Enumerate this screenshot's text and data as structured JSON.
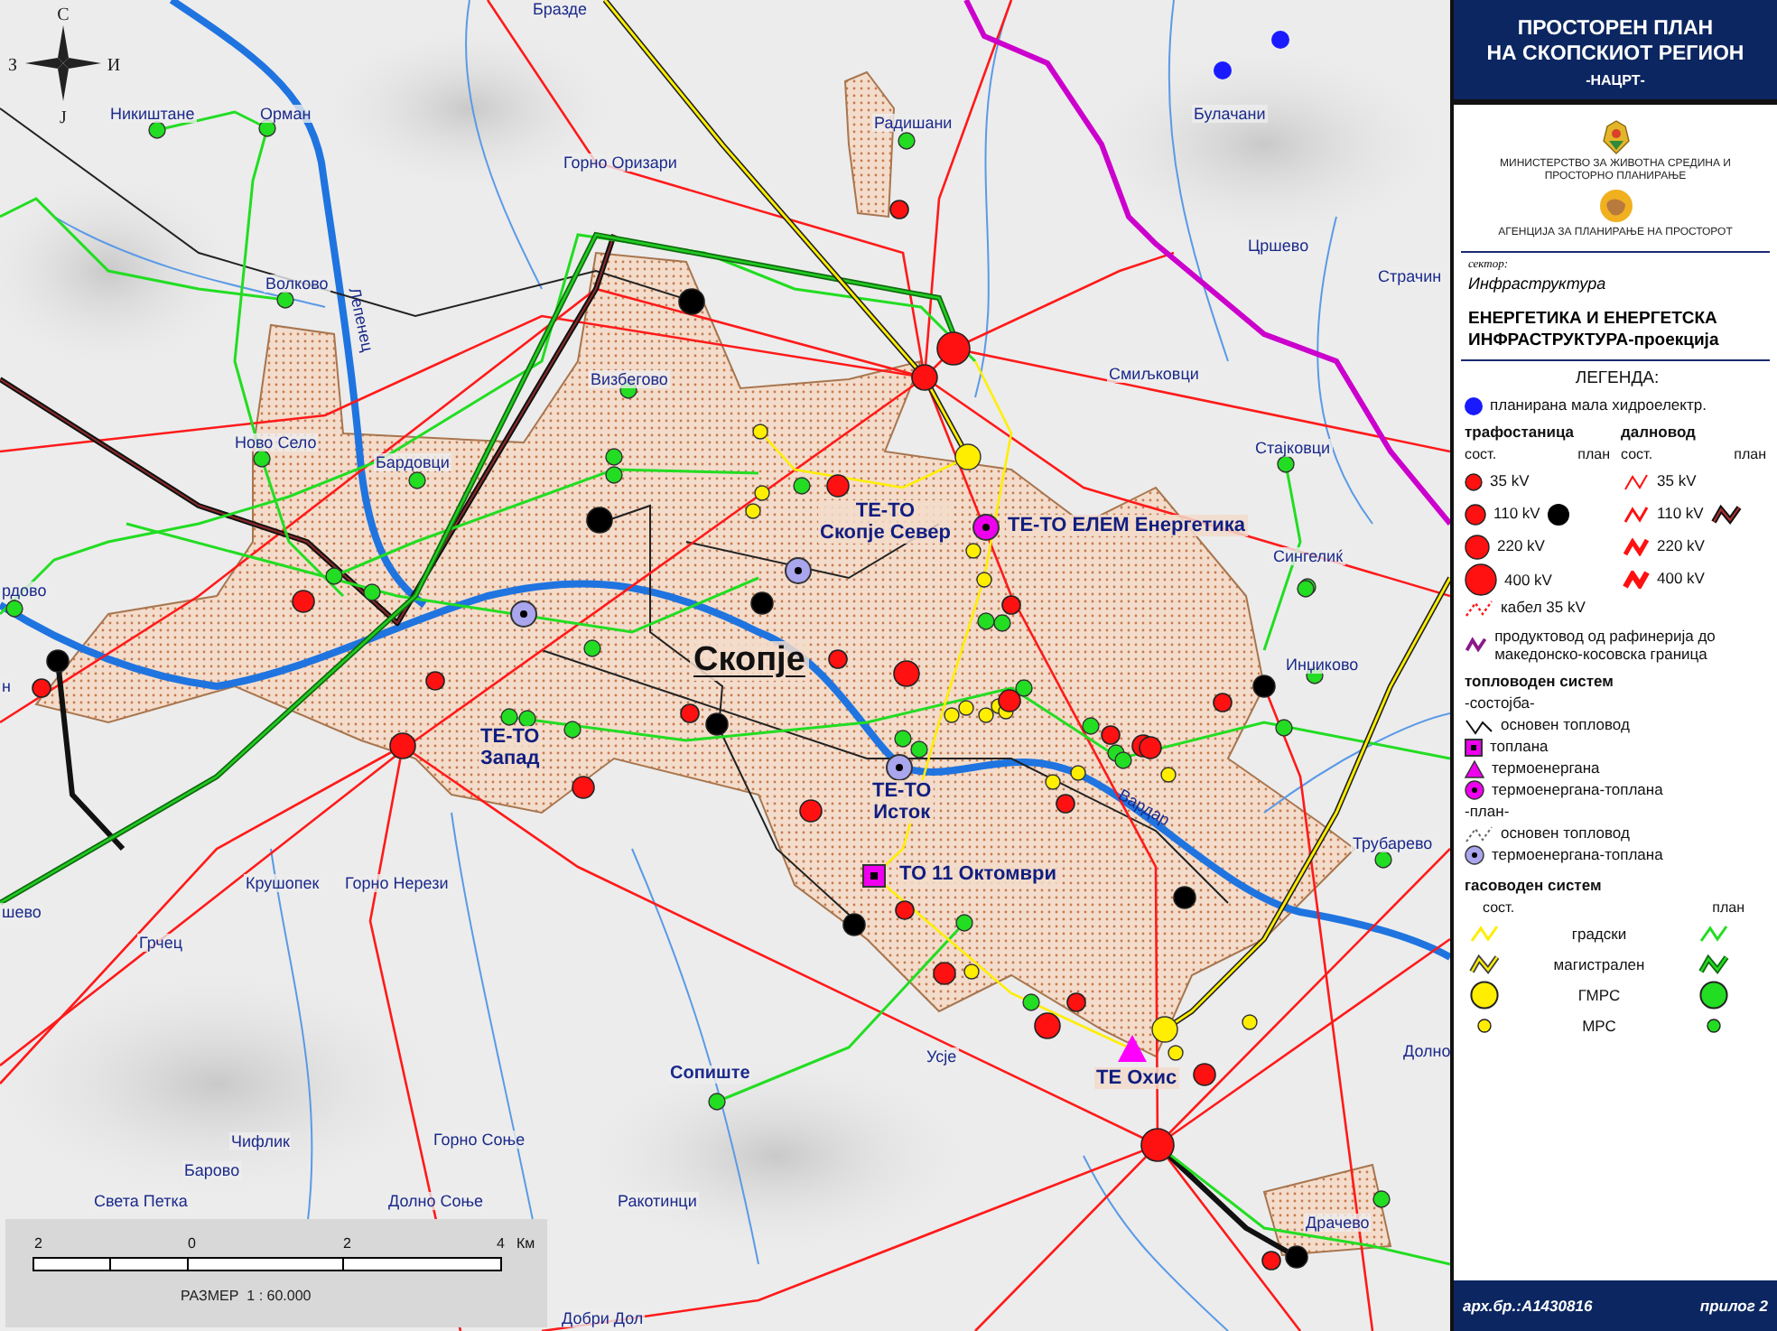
{
  "map": {
    "compass": {
      "north": "С",
      "west": "З",
      "east": "И",
      "south": "Ј"
    },
    "places": [
      {
        "name": "Бразде",
        "kind": "village"
      },
      {
        "name": "Никиштане",
        "kind": "village"
      },
      {
        "name": "Орман",
        "kind": "village"
      },
      {
        "name": "Горно Оризари",
        "kind": "village"
      },
      {
        "name": "Волково",
        "kind": "village"
      },
      {
        "name": "Визбегово",
        "kind": "village"
      },
      {
        "name": "Ново Село",
        "kind": "village"
      },
      {
        "name": "Бардовци",
        "kind": "village"
      },
      {
        "name": "Радишани",
        "kind": "village"
      },
      {
        "name": "Булачани",
        "kind": "village"
      },
      {
        "name": "Цршево",
        "kind": "village"
      },
      {
        "name": "Страчин",
        "kind": "village"
      },
      {
        "name": "Смиљковци",
        "kind": "village"
      },
      {
        "name": "Стајковци",
        "kind": "village"
      },
      {
        "name": "Сингелиќ",
        "kind": "village"
      },
      {
        "name": "Инџиково",
        "kind": "village"
      },
      {
        "name": "Трубарево",
        "kind": "village"
      },
      {
        "name": "Долно",
        "kind": "village"
      },
      {
        "name": "Усје",
        "kind": "village"
      },
      {
        "name": "Драчево",
        "kind": "village"
      },
      {
        "name": "рдово",
        "kind": "village"
      },
      {
        "name": "н",
        "kind": "village"
      },
      {
        "name": "шево",
        "kind": "village"
      },
      {
        "name": "Крушопек",
        "kind": "village"
      },
      {
        "name": "Горно Нерези",
        "kind": "village"
      },
      {
        "name": "Грчец",
        "kind": "village"
      },
      {
        "name": "Чифлик",
        "kind": "village"
      },
      {
        "name": "Барово",
        "kind": "village"
      },
      {
        "name": "Света Петка",
        "kind": "village"
      },
      {
        "name": "Горно Соње",
        "kind": "village"
      },
      {
        "name": "Долно Соње",
        "kind": "village"
      },
      {
        "name": "Ракотинци",
        "kind": "village"
      },
      {
        "name": "Добри Дол",
        "kind": "village"
      },
      {
        "name": "Сопиште",
        "kind": "municipality"
      }
    ],
    "facilities": [
      {
        "lines": [
          "ТЕ-ТО",
          "Скопје Север"
        ],
        "kind": "planned-cogeneration"
      },
      {
        "lines": [
          "ТЕ-ТО ЕЛЕМ Енергетика"
        ],
        "kind": "cogeneration"
      },
      {
        "lines": [
          "ТЕ-ТО",
          "Запад"
        ],
        "kind": "planned-cogeneration"
      },
      {
        "lines": [
          "ТЕ-ТО",
          "Исток"
        ],
        "kind": "planned-cogeneration"
      },
      {
        "lines": [
          "ТО 11 Октомври"
        ],
        "kind": "heating-plant"
      },
      {
        "lines": [
          "ТЕ Охис"
        ],
        "kind": "power-plant"
      }
    ],
    "city": "Скопје",
    "rivers": [
      "Лепенец",
      "Вардар"
    ],
    "scale_bar": {
      "ticks": [
        "2",
        "0",
        "2",
        "4"
      ],
      "unit": "Км",
      "caption": "РАЗМЕР  1 : 60.000"
    }
  },
  "panel": {
    "title_lines": [
      "ПРОСТОРЕН ПЛАН",
      "НА СКОПСКИОТ РЕГИОН"
    ],
    "subtitle": "-НАЦРТ-",
    "ministry": "МИНИСТЕРСТВО ЗА ЖИВОТНА СРЕДИНА И ПРОСТОРНО ПЛАНИРАЊЕ",
    "agency": "АГЕНЦИЈА ЗА ПЛАНИРАЊЕ НА ПРОСТОРОТ",
    "sector_label": "сектор:",
    "sector": "Инфраструктура",
    "heading": "ЕНЕРГЕТИКА И ЕНЕРГЕТСКА ИНФРАСТРУКТУРА-проекција",
    "legend": {
      "title": "ЛЕГЕНДА:",
      "hydro": "планирана мала хидроелектр.",
      "substations": {
        "title": "трафостаница",
        "existing": "сост.",
        "planned": "план",
        "levels": [
          "35 kV",
          "110 kV",
          "220 kV",
          "400 kV"
        ]
      },
      "power_lines": {
        "title": "далновод",
        "existing": "сост.",
        "planned": "план",
        "levels": [
          "35 kV",
          "110 kV",
          "220 kV",
          "400 kV"
        ]
      },
      "cable": "кабел 35 kV",
      "product_pipeline": "продуктовод од рафинерија до македонско-косовска граница",
      "heating": {
        "title": "топловоден систем",
        "existing_title": "-состојба-",
        "existing": [
          {
            "kind": "line",
            "label": "основен топловод"
          },
          {
            "kind": "square",
            "label": "топлана"
          },
          {
            "kind": "triangle",
            "label": "термоенергана"
          },
          {
            "kind": "dot",
            "label": "термоенергана-топлана"
          }
        ],
        "planned_title": "-план-",
        "planned": [
          {
            "kind": "dashed-line",
            "label": "основен топловод"
          },
          {
            "kind": "planned-dot",
            "label": "термоенергана-топлана"
          }
        ]
      },
      "gas": {
        "title": "гасоводен систем",
        "existing": "сост.",
        "planned": "план",
        "items": [
          {
            "kind": "city-line",
            "label": "градски"
          },
          {
            "kind": "main-line",
            "label": "магистрален"
          },
          {
            "kind": "large-station",
            "label": "ГМРС"
          },
          {
            "kind": "small-station",
            "label": "МРС"
          }
        ]
      }
    },
    "archive": "арх.бр.:А1430816",
    "annex": "прилог 2"
  }
}
